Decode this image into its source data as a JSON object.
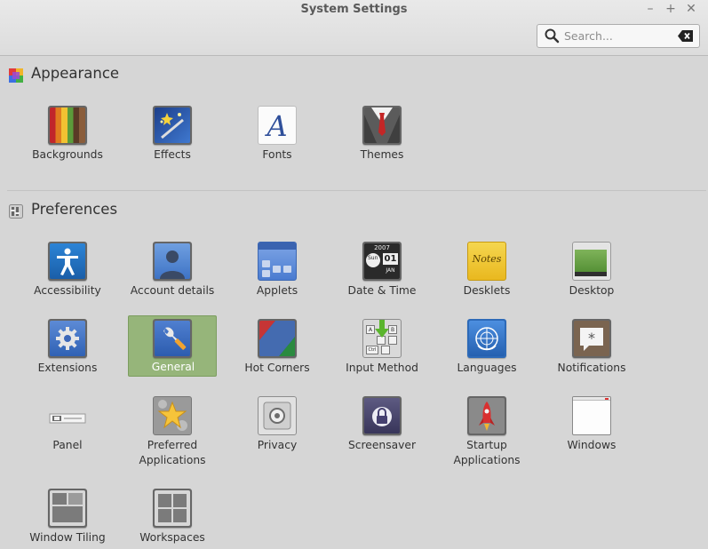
{
  "window": {
    "title": "System Settings",
    "controls": {
      "minimize": "–",
      "maximize": "+",
      "close": "✕"
    }
  },
  "search": {
    "placeholder": "Search...",
    "value": ""
  },
  "sections": [
    {
      "title": "Appearance",
      "icon": "palette-icon",
      "items": [
        {
          "label": "Backgrounds",
          "icon": "backgrounds-icon"
        },
        {
          "label": "Effects",
          "icon": "effects-icon"
        },
        {
          "label": "Fonts",
          "icon": "fonts-icon"
        },
        {
          "label": "Themes",
          "icon": "themes-icon"
        }
      ]
    },
    {
      "title": "Preferences",
      "icon": "preferences-icon",
      "items": [
        {
          "label": "Accessibility",
          "icon": "accessibility-icon"
        },
        {
          "label": "Account details",
          "icon": "account-icon"
        },
        {
          "label": "Applets",
          "icon": "applets-icon"
        },
        {
          "label": "Date & Time",
          "icon": "clock-icon",
          "clock": {
            "year": "2007",
            "day": "Sun",
            "date": "01",
            "month": "JAN"
          }
        },
        {
          "label": "Desklets",
          "icon": "desklets-icon",
          "note": "Notes"
        },
        {
          "label": "Desktop",
          "icon": "desktop-icon"
        },
        {
          "label": "Extensions",
          "icon": "extensions-icon"
        },
        {
          "label": "General",
          "icon": "general-icon",
          "selected": true
        },
        {
          "label": "Hot Corners",
          "icon": "hot-corners-icon"
        },
        {
          "label": "Input Method",
          "icon": "keyboard-icon",
          "keys": [
            "A",
            "B",
            "Ctrl"
          ]
        },
        {
          "label": "Languages",
          "icon": "globe-icon"
        },
        {
          "label": "Notifications",
          "icon": "notifications-icon"
        },
        {
          "label": "Panel",
          "icon": "panel-icon"
        },
        {
          "label": "Preferred\nApplications",
          "icon": "preferred-apps-icon"
        },
        {
          "label": "Privacy",
          "icon": "privacy-icon"
        },
        {
          "label": "Screensaver",
          "icon": "screensaver-icon"
        },
        {
          "label": "Startup\nApplications",
          "icon": "rocket-icon"
        },
        {
          "label": "Windows",
          "icon": "windows-icon"
        },
        {
          "label": "Window Tiling",
          "icon": "window-tiling-icon"
        },
        {
          "label": "Workspaces",
          "icon": "workspaces-icon"
        }
      ]
    }
  ],
  "colors": {
    "selection": "#96b57a",
    "background": "#d6d6d6"
  }
}
